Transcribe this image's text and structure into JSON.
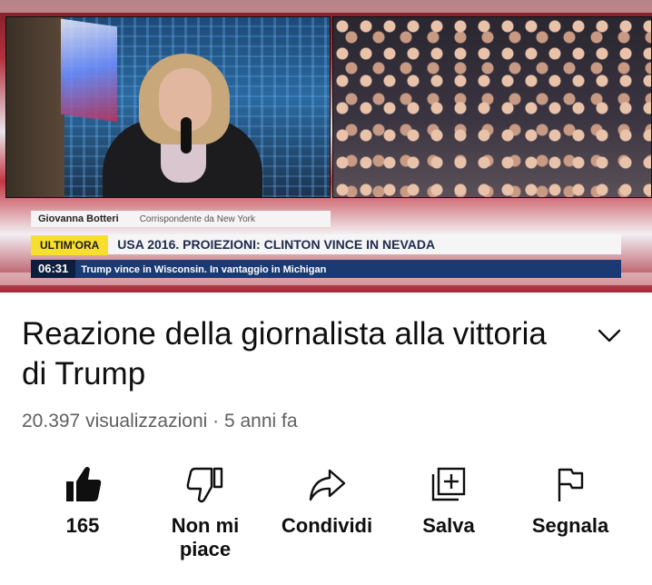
{
  "video": {
    "name_bar": {
      "name": "Giovanna Botteri",
      "role": "Corrispondente da New York"
    },
    "breaking": {
      "tag": "ULTIM'ORA",
      "headline": "USA 2016. PROIEZIONI: CLINTON VINCE IN NEVADA"
    },
    "ticker": {
      "time": "06:31",
      "text": "Trump vince in Wisconsin. In vantaggio in Michigan"
    }
  },
  "details": {
    "title": "Reazione della giornalista alla vittoria di Trump",
    "views": "20.397 visualizzazioni",
    "separator": " · ",
    "age": "5 anni fa"
  },
  "actions": {
    "like_count": "165",
    "dislike_line1": "Non mi",
    "dislike_line2": "piace",
    "share": "Condividi",
    "save": "Salva",
    "report": "Segnala"
  },
  "icons": {
    "expand": "chevron-down-icon",
    "like": "thumbs-up-filled-icon",
    "dislike": "thumbs-down-outline-icon",
    "share": "share-arrow-icon",
    "save": "add-to-playlist-icon",
    "report": "flag-icon"
  },
  "colors": {
    "text": "#0f0f0f",
    "secondary": "#606060",
    "ticker_blue": "#1b3a73",
    "tag_yellow": "#f6df2d"
  }
}
